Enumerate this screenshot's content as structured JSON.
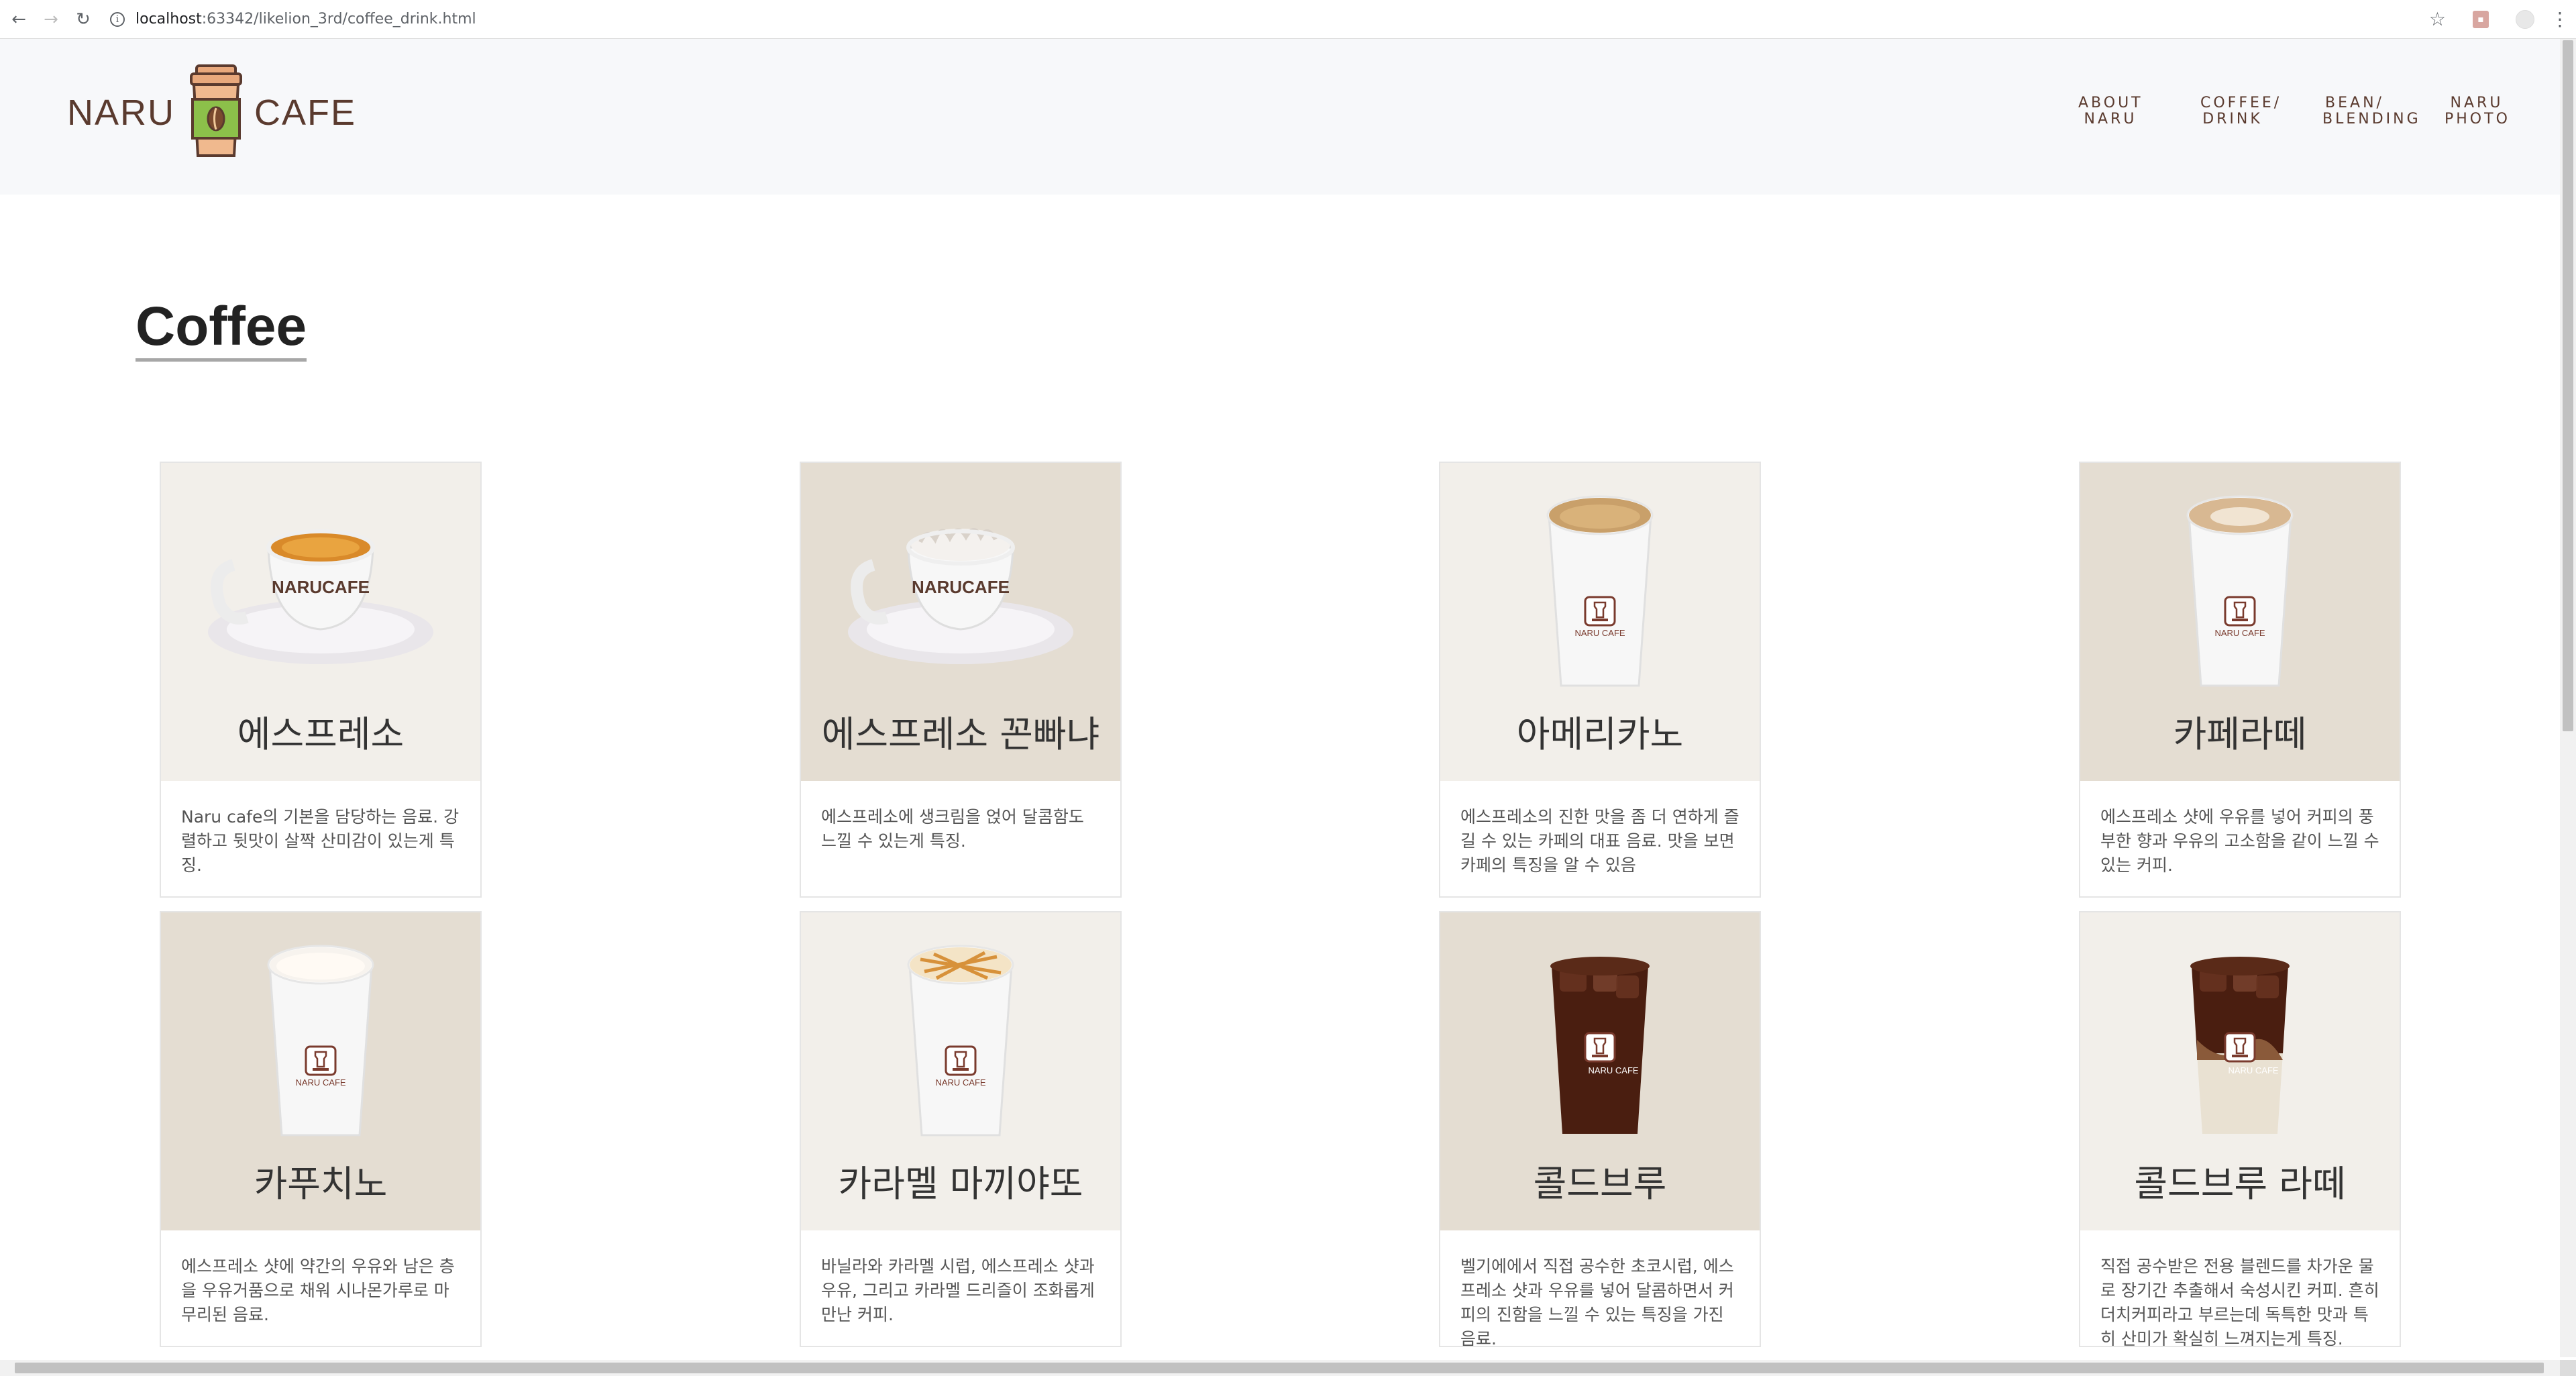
{
  "browser": {
    "url_host": "localhost",
    "url_rest": ":63342/likelion_3rd/coffee_drink.html"
  },
  "header": {
    "logo_left": "NARU",
    "logo_right": "CAFE",
    "nav": [
      {
        "line1": "ABOUT",
        "line2": "NARU"
      },
      {
        "line1": "COFFEE/",
        "line2": "DRINK"
      },
      {
        "line1": "BEAN/",
        "line2": "BLENDING"
      },
      {
        "line1": "NARU",
        "line2": "PHOTO"
      }
    ]
  },
  "main": {
    "section_title": "Coffee",
    "cards": [
      {
        "name": "에스프레소",
        "desc": "Naru cafe의 기본을 담당하는 음료. 강렬하고 뒷맛이 살짝 산미감이 있는게 특징.",
        "bg": "#f2efea",
        "img": "espresso-cup-icon"
      },
      {
        "name": "에스프레소 꼰빠냐",
        "desc": "에스프레소에 생크림을 얹어 달콤함도 느낄 수 있는게 특징.",
        "bg": "#e4ddd2",
        "img": "con-panna-cup-icon"
      },
      {
        "name": "아메리카노",
        "desc": "에스프레소의 진한 맛을 좀 더 연하게 즐길 수 있는 카페의 대표 음료. 맛을 보면 카페의 특징을 알 수 있음",
        "bg": "#f2efea",
        "img": "americano-cup-icon"
      },
      {
        "name": "카페라떼",
        "desc": "에스프레소 샷에 우유를 넣어 커피의 풍부한 향과 우유의 고소함을 같이 느낄 수 있는 커피.",
        "bg": "#e4ddd2",
        "img": "latte-cup-icon"
      },
      {
        "name": "카푸치노",
        "desc": "에스프레소 샷에 약간의 우유와 남은 층을 우유거품으로 채워 시나몬가루로 마무리된 음료.",
        "bg": "#e4ddd2",
        "img": "cappuccino-cup-icon"
      },
      {
        "name": "카라멜 마끼야또",
        "desc": "바닐라와 카라멜 시럽, 에스프레소 샷과 우유, 그리고 카라멜 드리즐이 조화롭게 만난 커피.",
        "bg": "#f2efea",
        "img": "caramel-macchiato-cup-icon"
      },
      {
        "name": "콜드브루",
        "desc": "벨기에에서 직접 공수한 초코시럽, 에스프레소 샷과 우유를 넣어 달콤하면서 커피의 진함을 느낄 수 있는 특징을 가진 음료.",
        "bg": "#e4ddd2",
        "img": "cold-brew-cup-icon"
      },
      {
        "name": "콜드브루 라떼",
        "desc": "직접 공수받은 전용 블렌드를 차가운 물로 장기간 추출해서 숙성시킨 커피. 흔히 더치커피라고 부르는데 독특한 맛과 특히 산미가 확실히 느껴지는게 특징.",
        "bg": "#f2efea",
        "img": "cold-brew-latte-cup-icon"
      }
    ]
  }
}
